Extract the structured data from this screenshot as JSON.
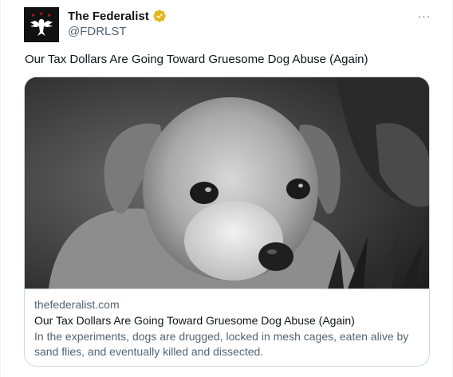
{
  "account": {
    "display_name": "The Federalist",
    "handle": "@FDRLST",
    "verified": true,
    "avatar_icon": "eagle-logo-icon"
  },
  "menu": {
    "more_icon": "more-options-icon",
    "more_label": "···"
  },
  "tweet": {
    "text": "Our Tax Dollars Are Going Toward Gruesome Dog Abuse (Again)"
  },
  "card": {
    "domain": "thefederalist.com",
    "title": "Our Tax Dollars Are Going Toward Gruesome Dog Abuse (Again)",
    "description": "In the experiments, dogs are drugged, locked in mesh cages, eaten alive by sand flies, and eventually killed and dissected.",
    "image_icon": "puppy-photo"
  },
  "colors": {
    "text_primary": "#0f1419",
    "text_secondary": "#536471",
    "border": "#cfd9de",
    "verified_gold": "#e2b719"
  }
}
